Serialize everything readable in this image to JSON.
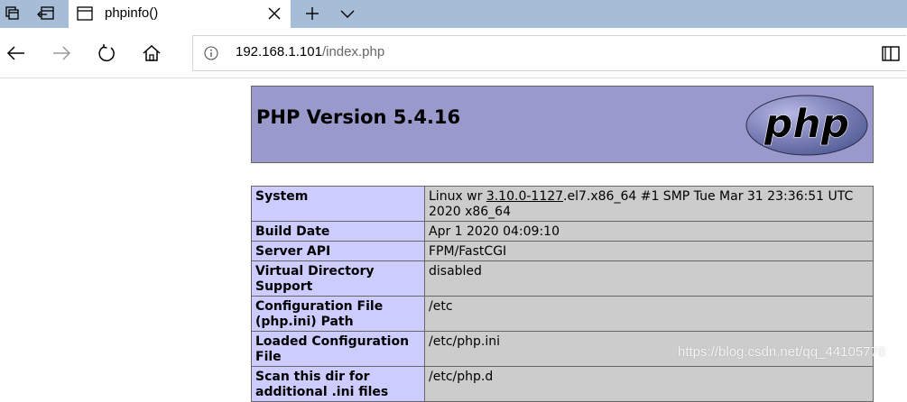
{
  "browser": {
    "tab": {
      "title": "phpinfo()"
    },
    "address": {
      "host": "192.168.1.101",
      "path": "/index.php"
    }
  },
  "icons": {
    "tab_manager": "tab-manager-icon",
    "set_aside": "set-aside-tabs-icon",
    "page": "page-icon",
    "close": "close-icon",
    "new_tab": "plus-icon",
    "tab_list": "chevron-down-icon",
    "back": "back-arrow-icon",
    "forward": "forward-arrow-icon",
    "refresh": "refresh-icon",
    "home": "home-icon",
    "info": "info-icon",
    "reading_view": "book-icon"
  },
  "phpinfo": {
    "version_title": "PHP Version 5.4.16",
    "logo_text": "php",
    "rows": [
      {
        "label": "System",
        "value_prefix": "Linux wr ",
        "value_link": "3.10.0-1127",
        "value_suffix": ".el7.x86_64 #1 SMP Tue Mar 31 23:36:51 UTC 2020 x86_64"
      },
      {
        "label": "Build Date",
        "value": "Apr 1 2020 04:09:10"
      },
      {
        "label": "Server API",
        "value": "FPM/FastCGI"
      },
      {
        "label": "Virtual Directory Support",
        "value": "disabled"
      },
      {
        "label": "Configuration File (php.ini) Path",
        "value": "/etc"
      },
      {
        "label": "Loaded Configuration File",
        "value": "/etc/php.ini"
      },
      {
        "label": "Scan this dir for additional .ini files",
        "value": "/etc/php.d"
      }
    ]
  },
  "watermark": "https://blog.csdn.net/qq_44105778",
  "colors": {
    "tabbar": "#a7bcd6",
    "php_header": "#9999cc",
    "label_cell": "#ccccff",
    "value_cell": "#cccccc"
  }
}
